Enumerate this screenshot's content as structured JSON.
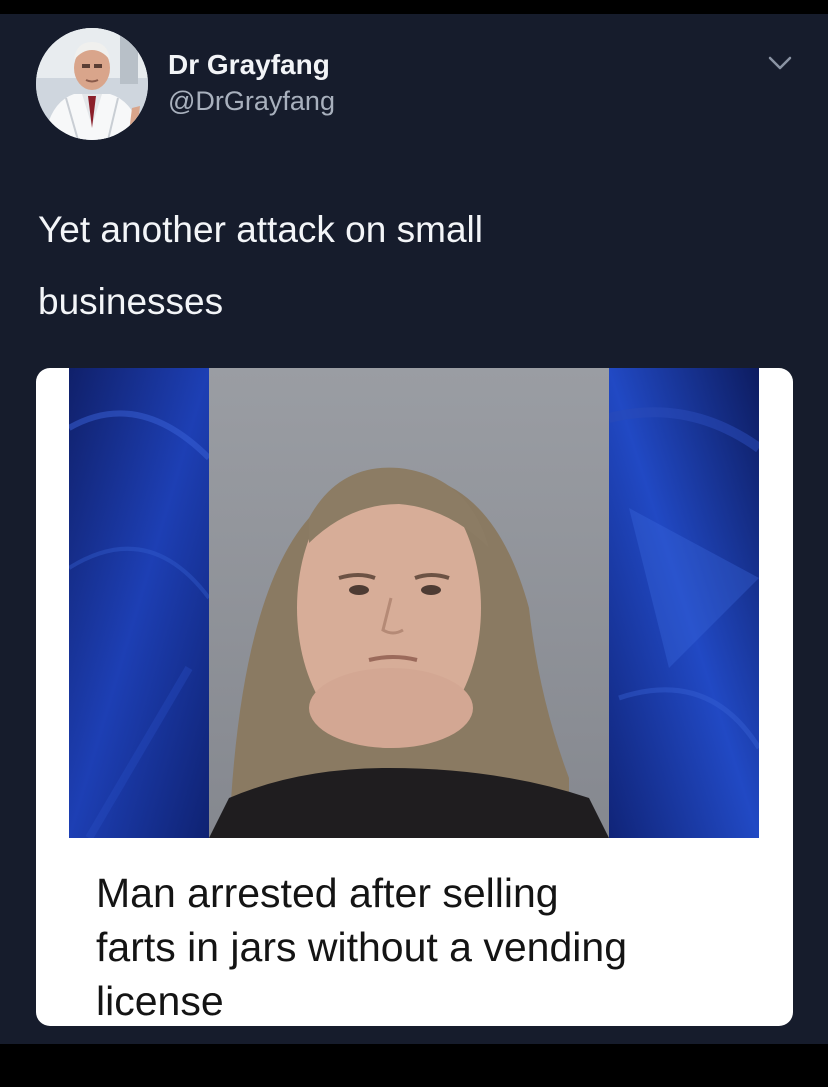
{
  "author": {
    "display_name": "Dr Grayfang",
    "handle": "@DrGrayfang",
    "avatar_icon": "doctor-portrait-avatar"
  },
  "tweet": {
    "text_lines": [
      "Yet another attack on small",
      "businesses"
    ]
  },
  "menu": {
    "icon": "chevron-down-icon"
  },
  "media": {
    "photo_icon": "mugshot-photo",
    "headline_lines": [
      "Man arrested after selling",
      "farts in jars without a vending",
      "license"
    ]
  },
  "colors": {
    "tweet_background": "#161c2c",
    "text_primary": "#f3f5f8",
    "text_secondary": "#a8b0bd",
    "card_background": "#ffffff",
    "photo_backdrop_blue": "#1a3fb0",
    "photo_wall_gray": "#8e9299"
  }
}
